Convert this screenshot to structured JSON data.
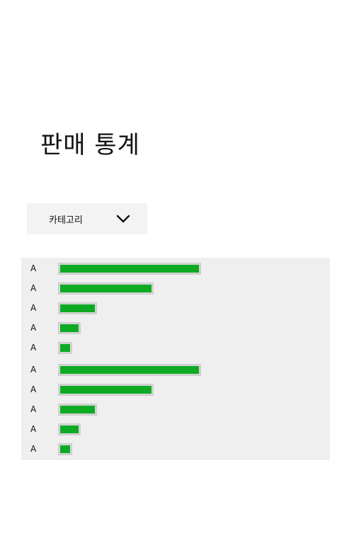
{
  "page": {
    "title": "판매 통계"
  },
  "category_dropdown": {
    "label": "카테고리",
    "icon": "chevron-down-icon"
  },
  "colors": {
    "bar": "#0eaa24",
    "panel_background": "#efefef",
    "dropdown_background": "#f3f3f3"
  },
  "chart_data": {
    "type": "bar",
    "orientation": "horizontal",
    "categories": [
      "A",
      "A",
      "A",
      "A",
      "A",
      "A",
      "A",
      "A",
      "A",
      "A"
    ],
    "values": [
      100,
      67,
      27,
      16,
      10,
      100,
      67,
      27,
      16,
      10
    ],
    "title": "",
    "xlabel": "",
    "ylabel": "",
    "xlim": [
      0,
      100
    ],
    "grid": false,
    "legend": "none"
  }
}
